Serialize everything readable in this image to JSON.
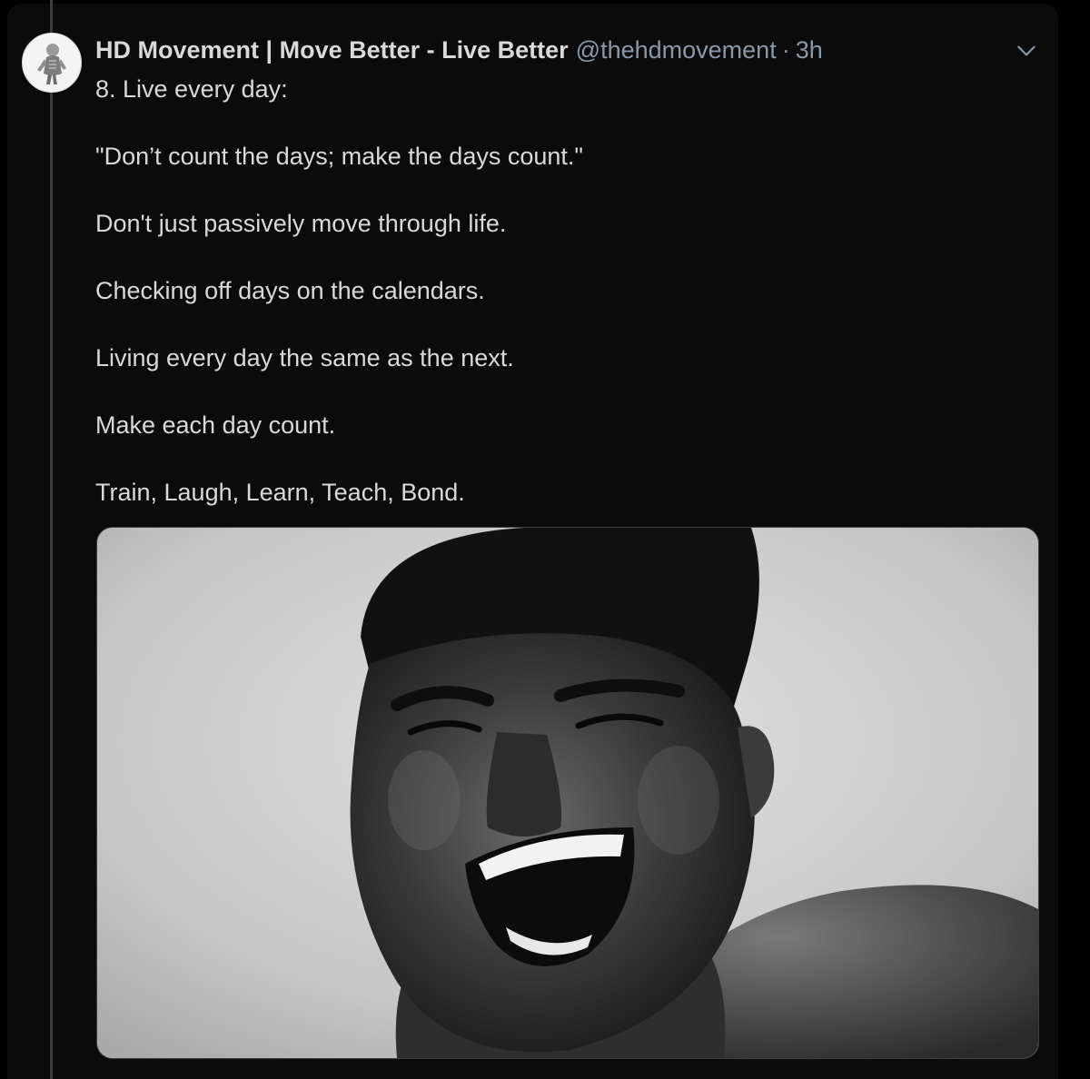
{
  "tweet": {
    "author": {
      "display_name": "HD Movement | Move Better - Live Better",
      "handle": "@thehdmovement",
      "separator": "·",
      "time": "3h"
    },
    "text_lines": [
      "8. Live every day:",
      "\"Don’t count the days; make the days count.\"",
      "Don't just passively move through life.",
      "Checking off days on the calendars.",
      "Living every day the same as the next.",
      "Make each day count.",
      "Train, Laugh, Learn, Teach, Bond."
    ],
    "media": {
      "description_icon": "photo",
      "style": "black-and-white"
    }
  },
  "icons": {
    "avatar": "anatomy-skeleton-logo",
    "more": "chevron-down-icon"
  },
  "colors": {
    "background": "#000000",
    "card": "#0b0b0c",
    "text_primary": "#d9d9d9",
    "text_secondary": "#8b98a5",
    "thread_line": "#3a3e42"
  }
}
